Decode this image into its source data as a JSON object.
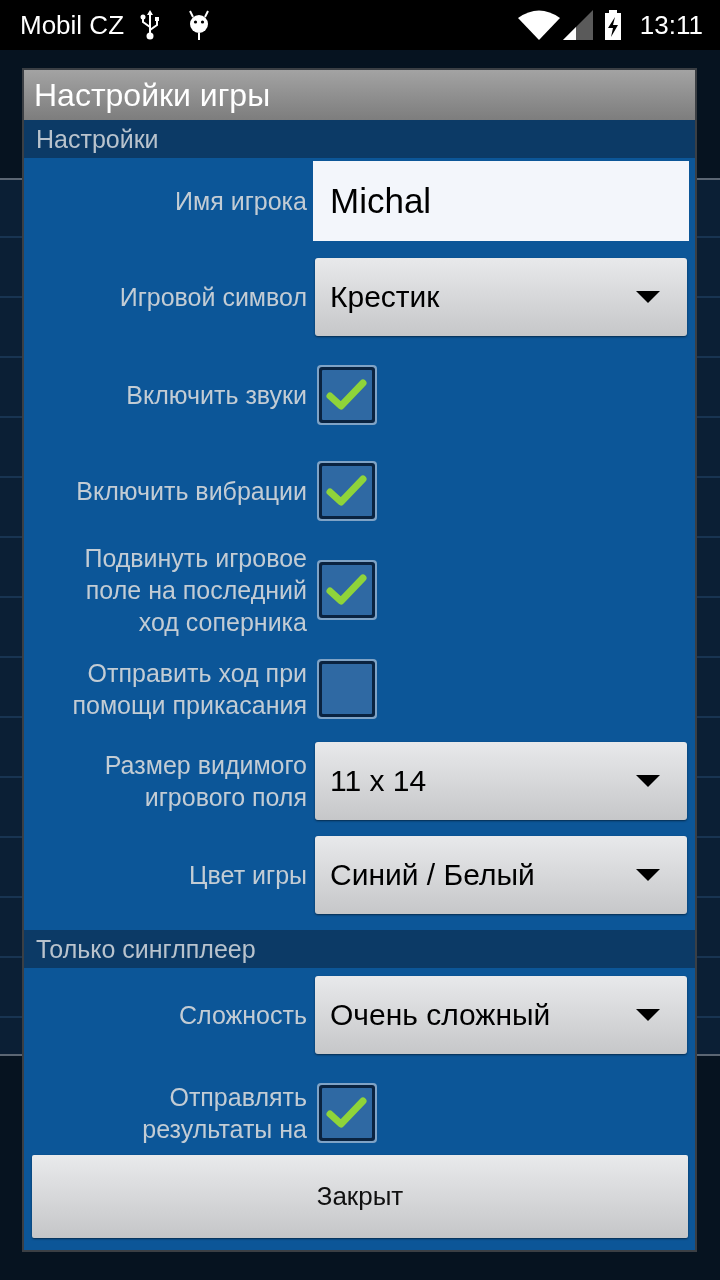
{
  "status_bar": {
    "carrier": "Mobil CZ",
    "time": "13:11"
  },
  "dialog": {
    "title": "Настройки игры",
    "sections": [
      {
        "header": "Настройки",
        "rows": [
          {
            "kind": "text",
            "label": "Имя игрока",
            "value": "Michal"
          },
          {
            "kind": "dropdown",
            "label": "Игровой символ",
            "value": "Крестик"
          },
          {
            "kind": "checkbox",
            "label": "Включить звуки",
            "checked": true
          },
          {
            "kind": "checkbox",
            "label": "Включить вибрации",
            "checked": true
          },
          {
            "kind": "checkbox",
            "label": "Подвинуть игровое\nполе на последний\nход соперника",
            "checked": true
          },
          {
            "kind": "checkbox",
            "label": "Отправить ход при\nпомощи прикасания",
            "checked": false
          },
          {
            "kind": "dropdown",
            "label": "Размер видимого\nигрового поля",
            "value": "11 x 14"
          },
          {
            "kind": "dropdown",
            "label": "Цвет игры",
            "value": "Синий / Белый"
          }
        ]
      },
      {
        "header": "Только синглплеер",
        "rows": [
          {
            "kind": "dropdown",
            "label": "Сложность",
            "value": "Очень сложный"
          },
          {
            "kind": "checkbox",
            "label": "Отправлять\nрезультаты на",
            "checked": true
          }
        ]
      }
    ],
    "buttons": [
      {
        "label": "Закрыт"
      }
    ]
  }
}
